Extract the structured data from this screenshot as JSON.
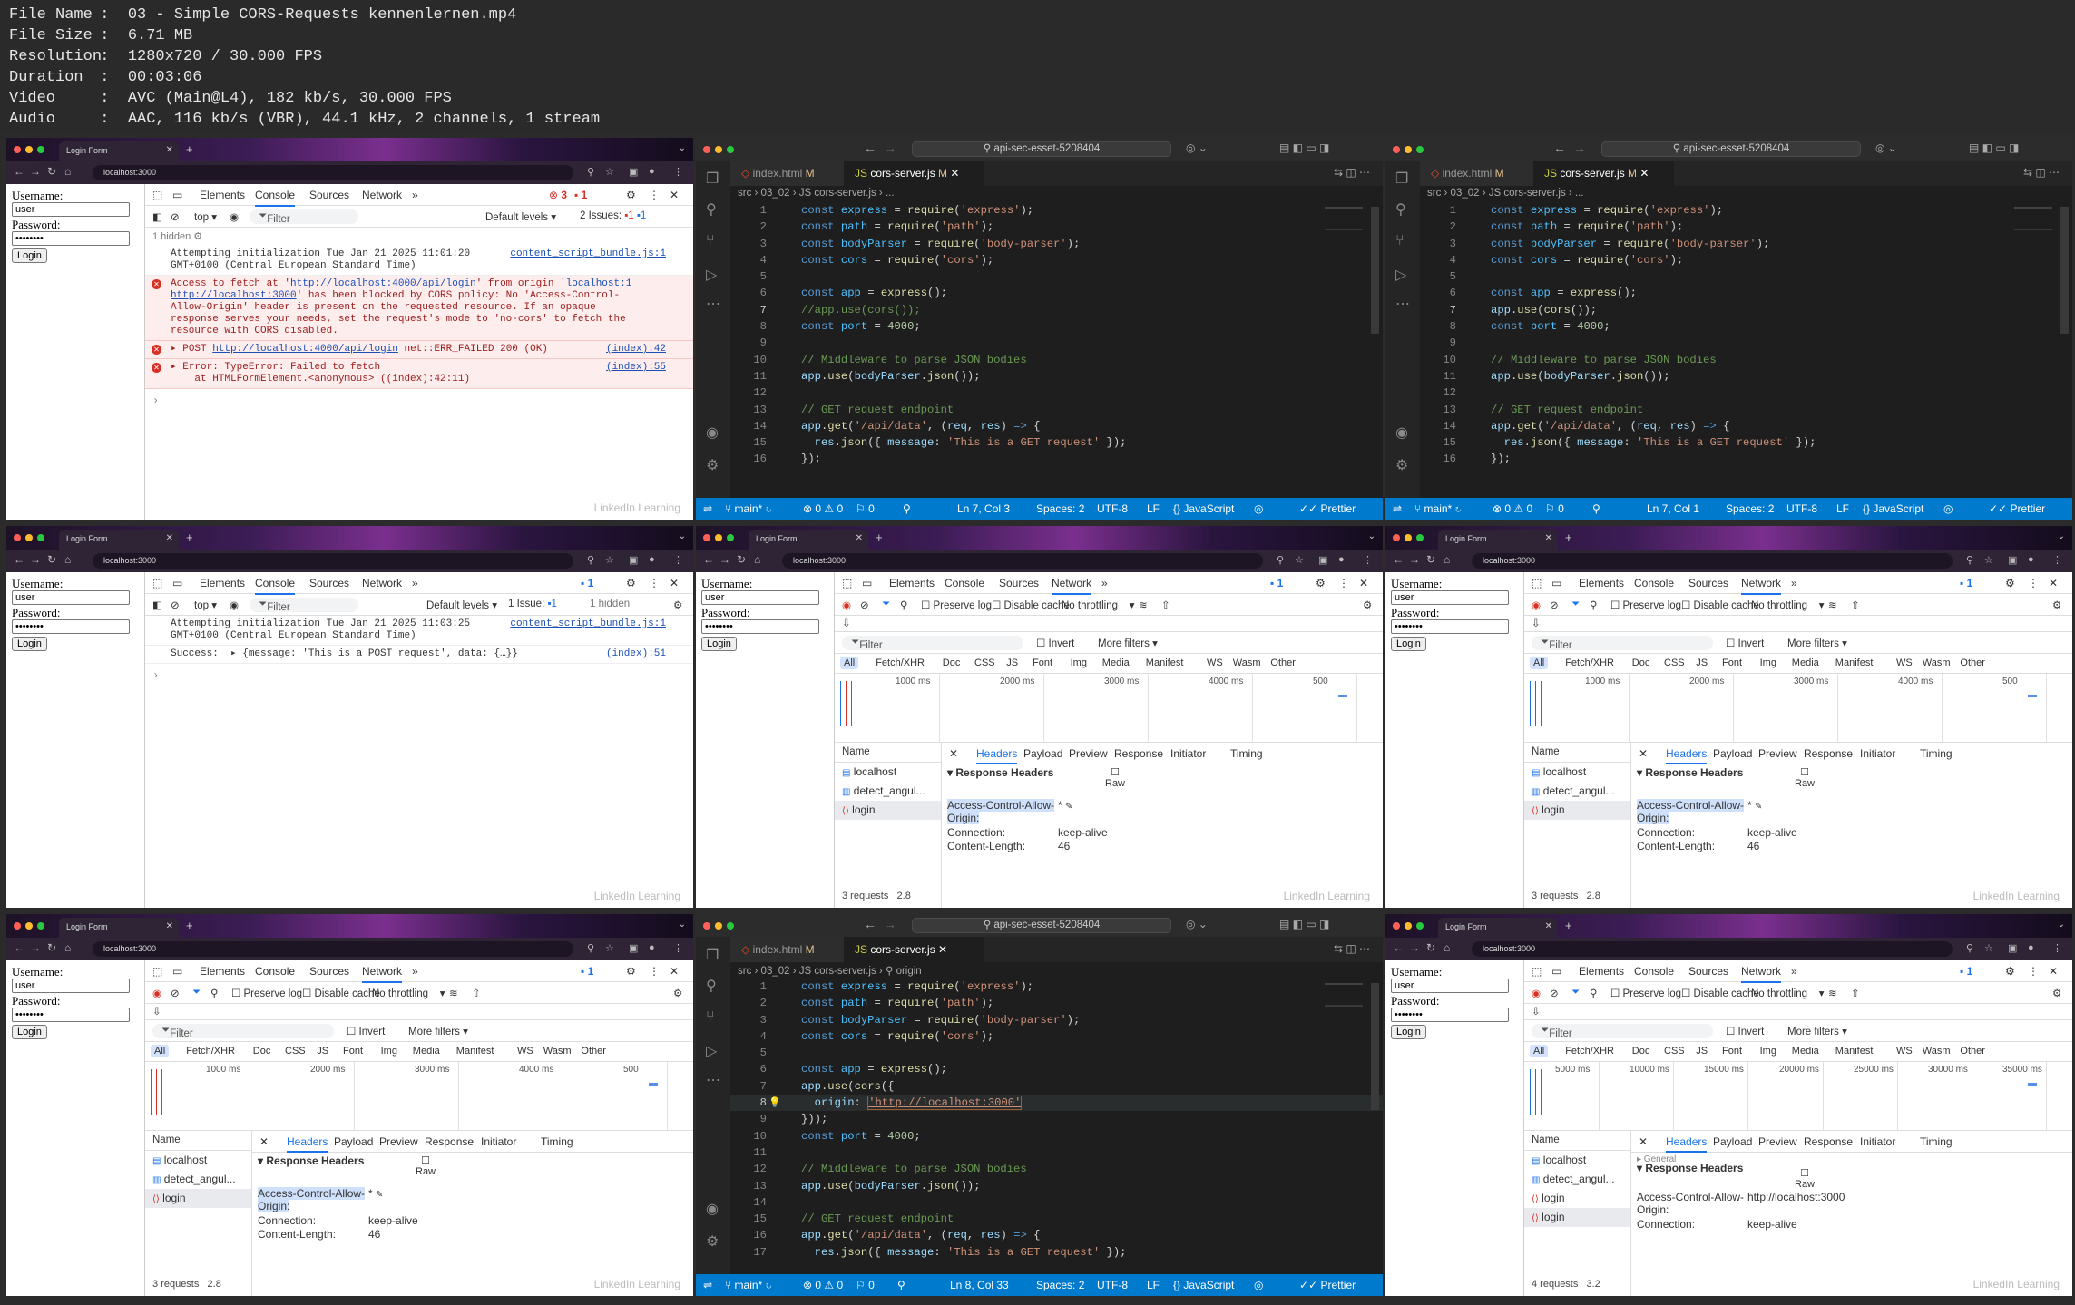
{
  "media_info": [
    {
      "key": "File Name",
      "value": "03 - Simple CORS-Requests kennenlernen.mp4"
    },
    {
      "key": "File Size",
      "value": "6.71 MB"
    },
    {
      "key": "Resolution",
      "value": "1280x720 / 30.000 FPS"
    },
    {
      "key": "Duration",
      "value": "00:03:06"
    },
    {
      "key": "Video",
      "value": "AVC (Main@L4), 182 kb/s, 30.000 FPS"
    },
    {
      "key": "Audio",
      "value": "AAC, 116 kb/s (VBR), 44.1 kHz, 2 channels, 1 stream"
    }
  ],
  "browser": {
    "tab_title": "Login Form",
    "address": "localhost:3000"
  },
  "login_form": {
    "username_label": "Username:",
    "username_value": "user",
    "password_label": "Password:",
    "password_value": "••••••••",
    "login_button": "Login"
  },
  "devtools": {
    "tabs": [
      "Elements",
      "Console",
      "Sources",
      "Network"
    ],
    "more": "»",
    "top_context": "top",
    "filter_placeholder": "Filter",
    "default_levels": "Default levels",
    "issues_2": "2 Issues:",
    "issues_1": "1 Issue:",
    "hidden_1": "1 hidden",
    "err_count": "3",
    "warn_count": "1",
    "badge_1": "1",
    "console1": {
      "init": "Attempting initialization Tue Jan 21 2025 11:01:20\nGMT+0100 (Central European Standard Time)",
      "init_src": "content_script_bundle.js:1",
      "cors_a": "Access to fetch at '",
      "cors_url": "http://localhost:4000/api/login",
      "cors_b": "' from origin '",
      "cors_origin": "localhost:1",
      "cors_c": "http://localhost:3000",
      "cors_d": "' has been blocked by CORS policy: No 'Access-Control-\nAllow-Origin' header is present on the requested resource. If an opaque\nresponse serves your needs, set the request's mode to 'no-cors' to fetch the\nresource with CORS disabled.",
      "post_a": "▸ POST ",
      "post_url": "http://localhost:4000/api/login",
      "post_b": " net::ERR_FAILED 200 (OK)",
      "post_src": "(index):42",
      "error_text": "▸ Error: TypeError: Failed to fetch\n    at HTMLFormElement.<anonymous> ((index):42:11)",
      "error_src": "(index):55"
    },
    "console2": {
      "init": "Attempting initialization Tue Jan 21 2025 11:03:25\nGMT+0100 (Central European Standard Time)",
      "init_src": "content_script_bundle.js:1",
      "success": "Success:  ▸ {message: 'This is a POST request', data: {…}}",
      "success_src": "(index):51"
    },
    "network": {
      "preserve_log": "Preserve log",
      "disable_cache": "Disable cache",
      "throttling": "No throttling",
      "invert": "Invert",
      "more_filters": "More filters",
      "categories": [
        "All",
        "Fetch/XHR",
        "Doc",
        "CSS",
        "JS",
        "Font",
        "Img",
        "Media",
        "Manifest",
        "WS",
        "Wasm",
        "Other"
      ],
      "ticks_a": [
        "1000 ms",
        "2000 ms",
        "3000 ms",
        "4000 ms",
        "500"
      ],
      "ticks_b": [
        "5000 ms",
        "10000 ms",
        "15000 ms",
        "20000 ms",
        "25000 ms",
        "30000 ms",
        "35000 ms"
      ],
      "name_header": "Name",
      "detail_tabs": [
        "Headers",
        "Payload",
        "Preview",
        "Response",
        "Initiator",
        "Timing"
      ],
      "rows_a": [
        "localhost",
        "detect_angul...",
        "login"
      ],
      "rows_b": [
        "localhost",
        "detect_angul...",
        "login",
        "login"
      ],
      "response_headers": "▾ Response Headers",
      "general": "▸ General",
      "raw": "Raw",
      "acao_line1": "Access-Control-Allow-",
      "acao_line2": "Origin:",
      "acao_value": "*",
      "acao_value_b": "http://localhost:3000",
      "connection": "Connection:",
      "connection_value": "keep-alive",
      "content_length": "Content-Length:",
      "content_length_value": "46",
      "requests_3": "3 requests",
      "requests_3_size": "2.8",
      "requests_4": "4 requests",
      "requests_4_size": "3.2"
    }
  },
  "vscode": {
    "search": "api-sec-esset-5208404",
    "tab1": "index.html",
    "tab1_mod": "M",
    "tab2": "cors-server.js",
    "tab2_mod": "M",
    "crumb": "src  ›  03_02  ›  JS cors-server.js  ›  ...",
    "crumb_origin": "src  ›  03_02  ›  JS cors-server.js  ›  ⚲ origin",
    "status_a": {
      "branch": "main*",
      "problems": "⊗ 0 ⚠ 0",
      "ports": "0",
      "pos": "Ln 7, Col 3",
      "spaces": "Spaces: 2",
      "enc": "UTF-8",
      "eol": "LF",
      "lang": "{} JavaScript",
      "prettier": "Prettier"
    },
    "status_b": {
      "pos": "Ln 7, Col 1"
    },
    "status_c": {
      "pos": "Ln 8, Col 33"
    }
  },
  "watermark": "LinkedIn Learning"
}
